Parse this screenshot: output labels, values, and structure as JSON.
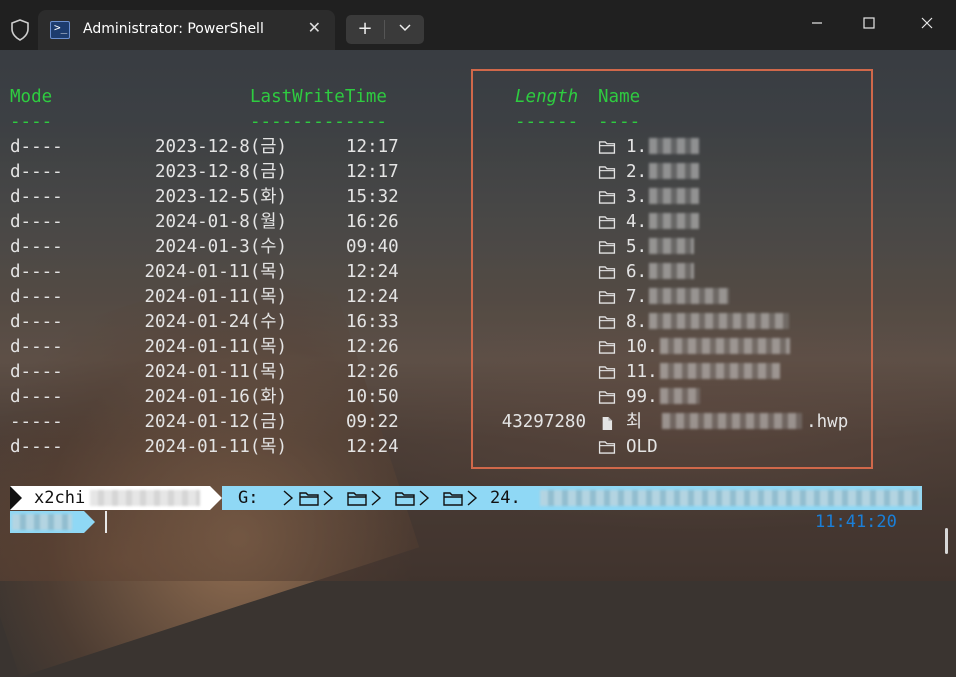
{
  "window": {
    "tab_title": "Administrator: PowerShell",
    "tab_close": "✕",
    "new_tab": "+",
    "dropdown": "⌄",
    "minimize": "—",
    "maximize": "☐",
    "close": "✕"
  },
  "table": {
    "headers": {
      "mode": "Mode",
      "lastwrite": "LastWriteTime",
      "length": "Length",
      "name": "Name"
    },
    "underline": {
      "mode": "----",
      "lastwrite": "-------------",
      "length": "------",
      "name": "----"
    },
    "rows": [
      {
        "mode": "d----",
        "date": "2023-12-8(금)",
        "time": "12:17",
        "length": "",
        "name": "1.",
        "type": "folder"
      },
      {
        "mode": "d----",
        "date": "2023-12-8(금)",
        "time": "12:17",
        "length": "",
        "name": "2.",
        "type": "folder"
      },
      {
        "mode": "d----",
        "date": "2023-12-5(화)",
        "time": "15:32",
        "length": "",
        "name": "3.",
        "type": "folder"
      },
      {
        "mode": "d----",
        "date": "2024-01-8(월)",
        "time": "16:26",
        "length": "",
        "name": "4.",
        "type": "folder"
      },
      {
        "mode": "d----",
        "date": "2024-01-3(수)",
        "time": "09:40",
        "length": "",
        "name": "5.",
        "type": "folder"
      },
      {
        "mode": "d----",
        "date": "2024-01-11(목)",
        "time": "12:24",
        "length": "",
        "name": "6.",
        "type": "folder"
      },
      {
        "mode": "d----",
        "date": "2024-01-11(목)",
        "time": "12:24",
        "length": "",
        "name": "7.",
        "type": "folder"
      },
      {
        "mode": "d----",
        "date": "2024-01-24(수)",
        "time": "16:33",
        "length": "",
        "name": "8.",
        "type": "folder"
      },
      {
        "mode": "d----",
        "date": "2024-01-11(목)",
        "time": "12:26",
        "length": "",
        "name": "10.",
        "type": "folder"
      },
      {
        "mode": "d----",
        "date": "2024-01-11(목)",
        "time": "12:26",
        "length": "",
        "name": "11.",
        "type": "folder"
      },
      {
        "mode": "d----",
        "date": "2024-01-16(화)",
        "time": "10:50",
        "length": "",
        "name": "99.",
        "type": "folder"
      },
      {
        "mode": "-----",
        "date": "2024-01-12(금)",
        "time": "09:22",
        "length": "43297280",
        "name": "최",
        "suffix": ".hwp",
        "type": "file"
      },
      {
        "mode": "d----",
        "date": "2024-01-11(목)",
        "time": "12:24",
        "length": "",
        "name": "OLD",
        "type": "folder"
      }
    ]
  },
  "prompt": {
    "user": "x2chi",
    "path_drive": "G:",
    "path_tail": "24.",
    "clock": "11:41:20"
  }
}
